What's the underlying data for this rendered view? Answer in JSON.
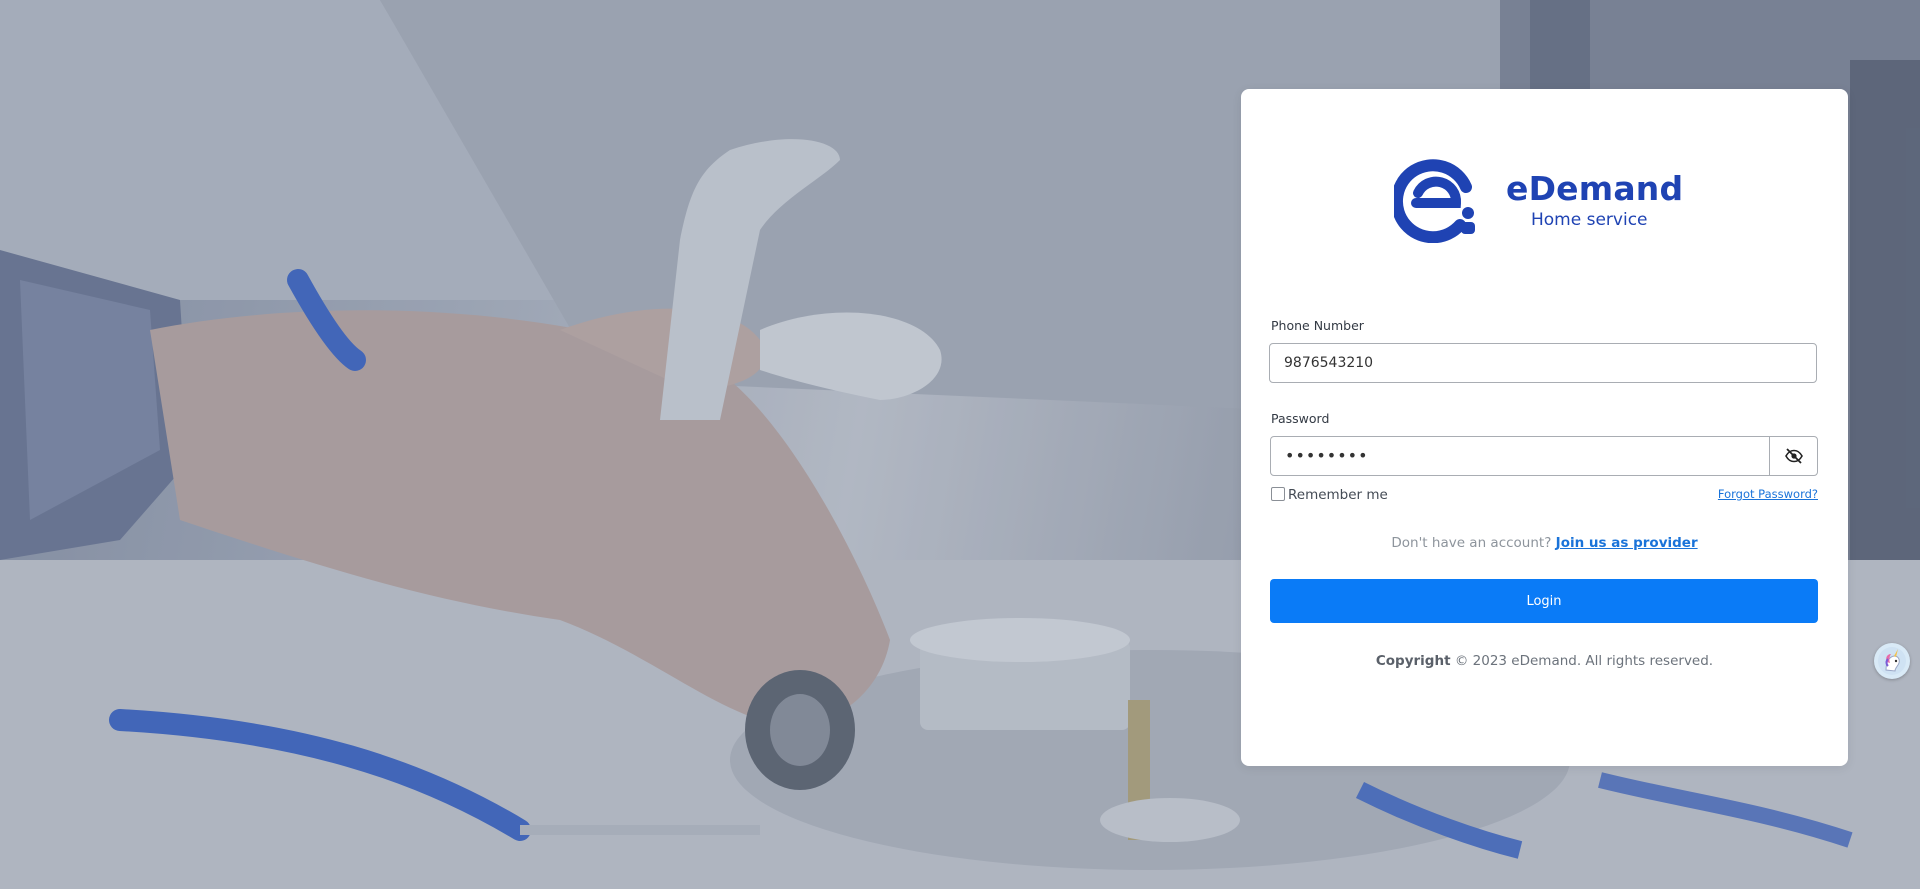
{
  "brand": {
    "name": "eDemand",
    "tagline": "Home service"
  },
  "login_form": {
    "phone_label": "Phone Number",
    "phone_value": "9876543210",
    "password_label": "Password",
    "password_value": "••••••••",
    "remember_label": "Remember me",
    "forgot_label": "Forgot Password?",
    "signup_prompt": "Don't have an account?",
    "signup_link": "Join us as provider",
    "submit_label": "Login"
  },
  "footer": {
    "copyright_bold": "Copyright",
    "copyright_rest": "© 2023 eDemand. All rights reserved."
  },
  "colors": {
    "brand": "#1f43b3",
    "primary_button": "#0a7bf7",
    "link": "#1a73d9"
  },
  "icons": {
    "password_toggle": "eye-slash-icon",
    "assistant_widget": "unicorn-icon"
  }
}
